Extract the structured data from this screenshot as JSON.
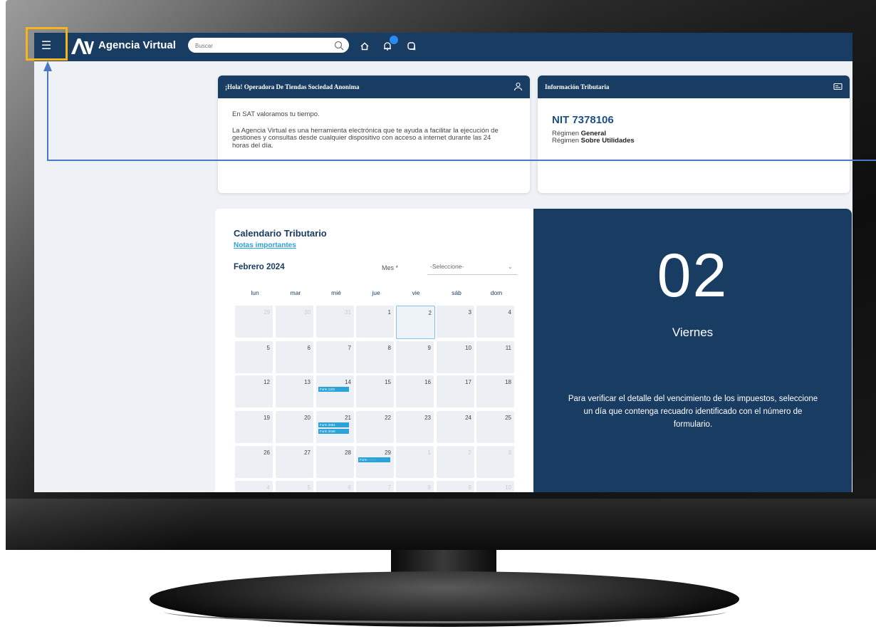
{
  "app": {
    "title": "Agencia Virtual"
  },
  "search": {
    "placeholder": "Buscar"
  },
  "welcome": {
    "heading": "¡Hola! Operadora De Tiendas Sociedad Anonima",
    "line1": "En SAT valoramos tu tiempo.",
    "line2": "La Agencia Virtual es una herramienta electrónica que te ayuda a facilitar la ejecución de gestiones y consultas desde cualquier dispositivo con acceso a internet durante las 24 horas del día."
  },
  "tax_info": {
    "heading": "Información Tributaria",
    "nit": "NIT 7378106",
    "regimen_label": "Régimen",
    "regimen1": "General",
    "regimen2": "Sobre Utilidades"
  },
  "calendar": {
    "title": "Calendario Tributario",
    "notes_link": "Notas importantes",
    "month": "Febrero 2024",
    "mes_label": "Mes *",
    "select_value": "-Seleccione-",
    "weekdays": [
      "lun",
      "mar",
      "mié",
      "jue",
      "vie",
      "sáb",
      "dom"
    ],
    "weeks": [
      [
        "29",
        "30",
        "31",
        "1",
        "2",
        "3",
        "4"
      ],
      [
        "5",
        "6",
        "7",
        "8",
        "9",
        "10",
        "11"
      ],
      [
        "12",
        "13",
        "14",
        "15",
        "16",
        "17",
        "18"
      ],
      [
        "19",
        "20",
        "21",
        "22",
        "23",
        "24",
        "25"
      ],
      [
        "26",
        "27",
        "28",
        "29",
        "1",
        "2",
        "3"
      ],
      [
        "4",
        "5",
        "6",
        "7",
        "8",
        "9",
        "10"
      ]
    ],
    "tags": {
      "d14": "Form 1311",
      "d21a": "Form 2051",
      "d21b": "Form 2046",
      "d29": "Form ········"
    }
  },
  "detail": {
    "day_number": "02",
    "day_name": "Viernes",
    "message": "Para verificar el detalle del vencimiento de los impuestos, seleccione un día que contenga recuadro identificado con el número de formulario."
  },
  "colors": {
    "brand": "#193c63",
    "accent": "#29a3d8",
    "highlight": "#f5b51d",
    "arrow": "#4a78c8"
  }
}
